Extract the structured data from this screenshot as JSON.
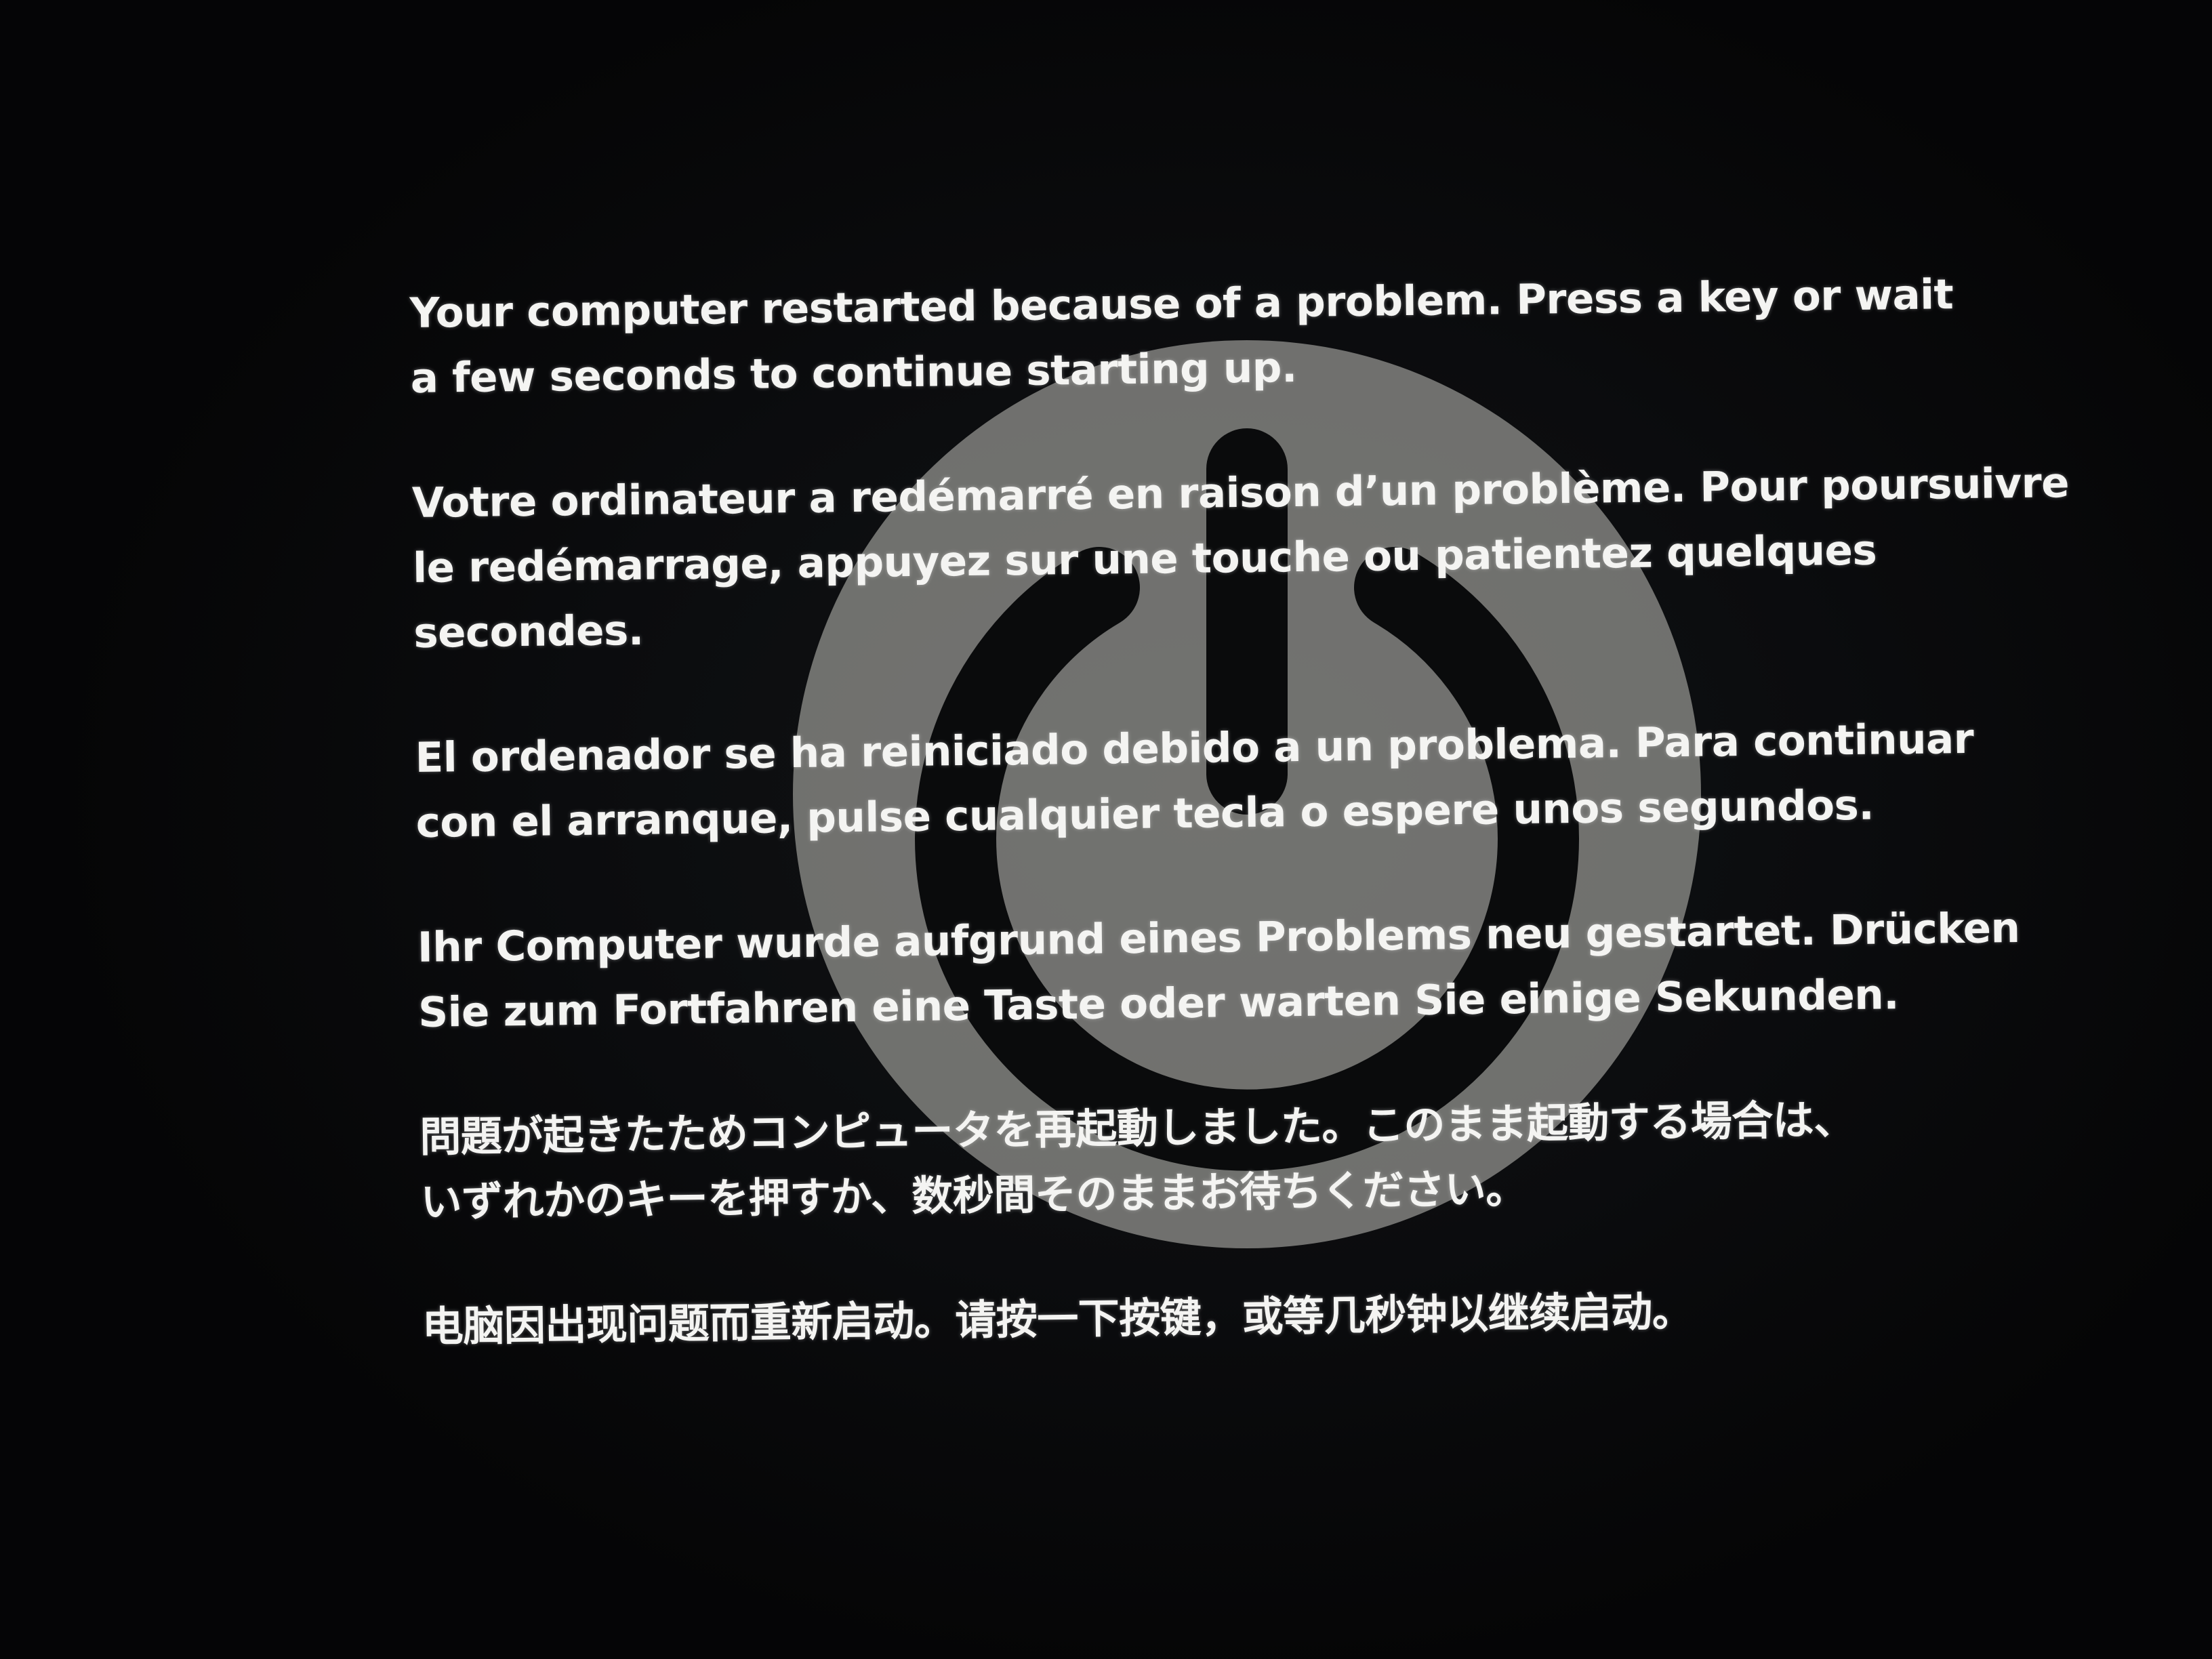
{
  "icons": {
    "background_icon": "power-icon"
  },
  "colors": {
    "background": "#060708",
    "text": "#f4f4f2",
    "icon": "#9a9a96"
  },
  "messages": {
    "en": "Your computer restarted because of a problem. Press a key or wait\na few seconds to continue starting up.",
    "fr": "Votre ordinateur a redémarré en raison d’un problème. Pour poursuivre\nle redémarrage, appuyez sur une touche ou patientez quelques secondes.",
    "es": "El ordenador se ha reiniciado debido a un problema. Para continuar\ncon el arranque, pulse cualquier tecla o espere unos segundos.",
    "de": "Ihr Computer wurde aufgrund eines Problems neu gestartet. Drücken\nSie zum Fortfahren eine Taste oder warten Sie einige Sekunden.",
    "ja": "問題が起きたためコンピュータを再起動しました。このまま起動する場合は、\nいずれかのキーを押すか、数秒間そのままお待ちください。",
    "zh": "电脑因出现问题而重新启动。请按一下按键，或等几秒钟以继续启动。"
  }
}
